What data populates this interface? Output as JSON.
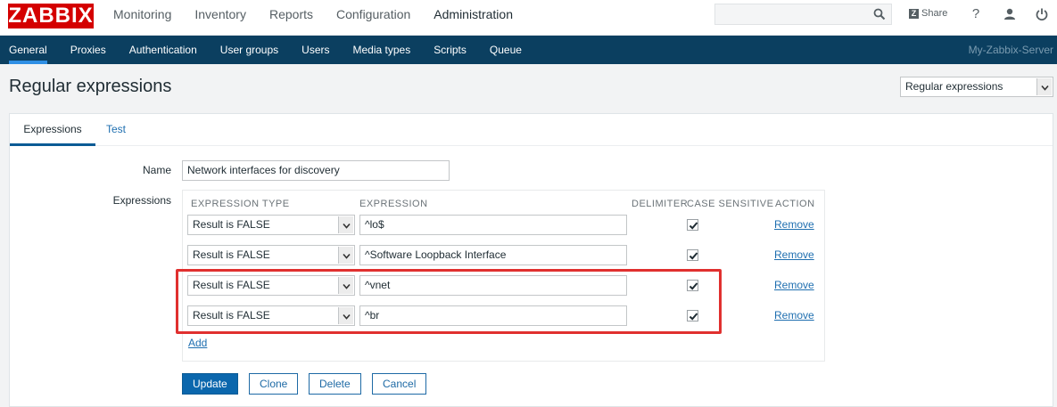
{
  "header": {
    "logo": "ZABBIX",
    "menu": [
      "Monitoring",
      "Inventory",
      "Reports",
      "Configuration",
      "Administration"
    ],
    "active_menu": "Administration",
    "share_label": "Share",
    "help_label": "?",
    "accent": "#d40000"
  },
  "subnav": {
    "items": [
      "General",
      "Proxies",
      "Authentication",
      "User groups",
      "Users",
      "Media types",
      "Scripts",
      "Queue"
    ],
    "active": "General",
    "server_name": "My-Zabbix-Server",
    "background": "#0b3f60"
  },
  "page": {
    "title": "Regular expressions",
    "selector_value": "Regular expressions"
  },
  "tabs": [
    "Expressions",
    "Test"
  ],
  "form": {
    "name_label": "Name",
    "name_value": "Network interfaces for discovery",
    "expressions_label": "Expressions",
    "columns": [
      "EXPRESSION TYPE",
      "EXPRESSION",
      "DELIMITER",
      "CASE SENSITIVE",
      "ACTION"
    ],
    "rows": [
      {
        "type": "Result is FALSE",
        "expression": "^lo$",
        "case_sensitive": true,
        "action": "Remove"
      },
      {
        "type": "Result is FALSE",
        "expression": "^Software Loopback Interface",
        "case_sensitive": true,
        "action": "Remove"
      },
      {
        "type": "Result is FALSE",
        "expression": "^vnet",
        "case_sensitive": true,
        "action": "Remove"
      },
      {
        "type": "Result is FALSE",
        "expression": "^br",
        "case_sensitive": true,
        "action": "Remove"
      }
    ],
    "add_label": "Add",
    "highlight_color": "#e0302f"
  },
  "buttons": {
    "update": "Update",
    "clone": "Clone",
    "delete": "Delete",
    "cancel": "Cancel"
  }
}
